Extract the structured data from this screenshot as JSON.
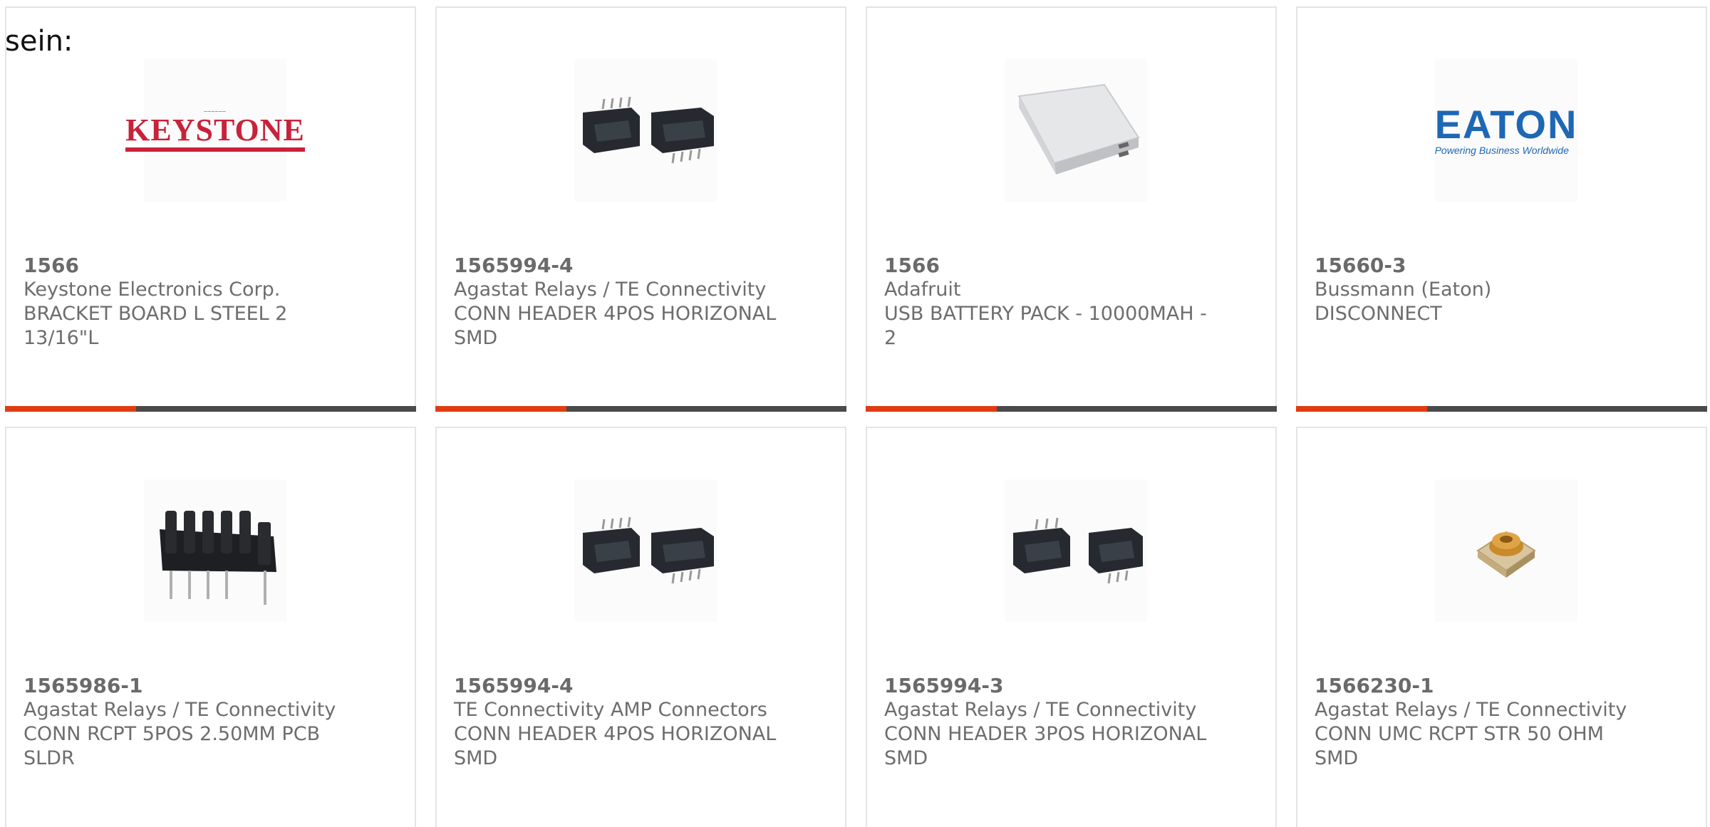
{
  "intro_text": "sein:",
  "colors": {
    "accent": "#e03c12",
    "bar": "#4a4a4a",
    "card_border": "#e4e4e4",
    "text": "#6d6d6d"
  },
  "products": [
    {
      "part_number": "1566",
      "manufacturer": "Keystone Electronics Corp.",
      "description": "BRACKET BOARD L STEEL 2 13/16\"L",
      "image": "keystone-logo",
      "logo_text": "KEYSTONE"
    },
    {
      "part_number": "1565994-4",
      "manufacturer": "Agastat Relays / TE Connectivity",
      "description": "CONN HEADER 4POS HORIZONAL SMD",
      "image": "connector-header-pair"
    },
    {
      "part_number": "1566",
      "manufacturer": "Adafruit",
      "description": "USB BATTERY PACK - 10000MAH - 2",
      "image": "battery-pack"
    },
    {
      "part_number": "15660-3",
      "manufacturer": "Bussmann (Eaton)",
      "description": "DISCONNECT",
      "image": "eaton-logo",
      "logo_text": "EATON",
      "logo_subtext": "Powering Business Worldwide"
    },
    {
      "part_number": "1565986-1",
      "manufacturer": "Agastat Relays / TE Connectivity",
      "description": "CONN RCPT 5POS 2.50MM PCB SLDR",
      "image": "receptacle-connector"
    },
    {
      "part_number": "1565994-4",
      "manufacturer": "TE Connectivity AMP Connectors",
      "description": "CONN HEADER 4POS HORIZONAL SMD",
      "image": "connector-header-pair"
    },
    {
      "part_number": "1565994-3",
      "manufacturer": "Agastat Relays / TE Connectivity",
      "description": "CONN HEADER 3POS HORIZONAL SMD",
      "image": "connector-header-pair"
    },
    {
      "part_number": "1566230-1",
      "manufacturer": "Agastat Relays / TE Connectivity",
      "description": "CONN UMC RCPT STR 50 OHM SMD",
      "image": "umc-connector"
    }
  ]
}
